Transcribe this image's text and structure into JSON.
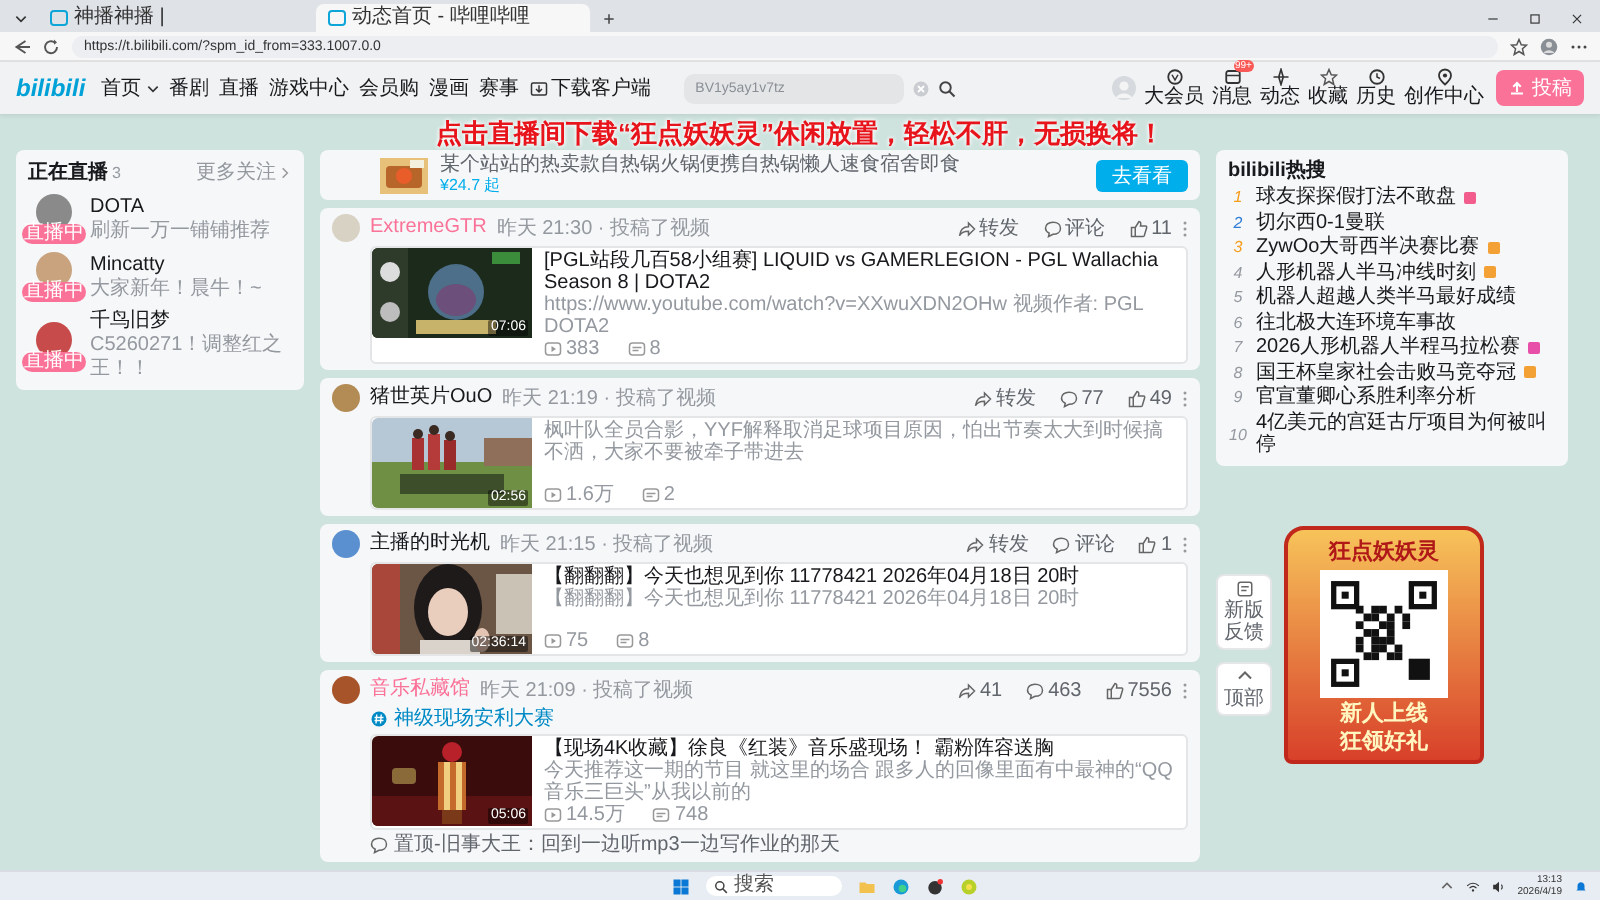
{
  "browser": {
    "tabs": [
      {
        "title": "神播神播 | ",
        "selected": false
      },
      {
        "title": "动态首页 - 哔哩哔哩",
        "selected": true
      }
    ],
    "url": "https://t.bilibili.com/?spm_id_from=333.1007.0.0"
  },
  "header": {
    "logo": "bilibili",
    "nav": [
      {
        "label": "首页",
        "kind": "dropdown"
      },
      {
        "label": "番剧",
        "kind": "link"
      },
      {
        "label": "直播",
        "kind": "link"
      },
      {
        "label": "游戏中心",
        "kind": "link"
      },
      {
        "label": "会员购",
        "kind": "link"
      },
      {
        "label": "漫画",
        "kind": "link"
      },
      {
        "label": "赛事",
        "kind": "link"
      },
      {
        "label": "下载客户端",
        "kind": "download"
      }
    ],
    "search": {
      "placeholder": "BV1y5ay1v7tz"
    },
    "user_menu": [
      {
        "label": "大会员",
        "kind": "vip"
      },
      {
        "label": "消息",
        "kind": "message",
        "badge": "99+"
      },
      {
        "label": "动态",
        "kind": "dynamic"
      },
      {
        "label": "收藏",
        "kind": "star"
      },
      {
        "label": "历史",
        "kind": "history"
      },
      {
        "label": "创作中心",
        "kind": "creator"
      }
    ],
    "upload_button": "投稿"
  },
  "banner": "点击直播间下载“狂点妖妖灵”休闲放置，轻松不肝，无损换将！",
  "live_panel": {
    "title": "正在直播",
    "count": "3",
    "more": "更多关注",
    "items": [
      {
        "name": "DOTA",
        "subtitle": "刷新一万一铺铺推荐",
        "badge": "直播中",
        "color": "#8a8a8a"
      },
      {
        "name": "Mincatty",
        "subtitle": "大家新年！晨牛！~",
        "badge": "直播中",
        "color": "#c9a27e"
      },
      {
        "name": "千鸟旧梦",
        "subtitle": "C5260271！调整红之王！！",
        "badge": "直播中",
        "color": "#c84b4b"
      }
    ]
  },
  "promo": {
    "text": "某个站站的热卖款自热锅火锅便携自热锅懒人速食宿舍即食",
    "price": "¥24.7 起",
    "button": "去看看"
  },
  "posts": [
    {
      "author": "ExtremeGTR",
      "vip": true,
      "time": "昨天 21:30 · 投稿了视频",
      "kind": "picture",
      "duration": "07:06",
      "title": "[PGL站段几百58小组赛] LIQUID vs GAMERLEGION - PGL Wallachia Season 8 | DOTA2",
      "desc": "https://www.youtube.com/watch?v=XXwuXDN2OHw 视频作者: PGL DOTA2",
      "views": "383",
      "danmaku": "8",
      "actions": [
        {
          "kind": "share",
          "label": "转发"
        },
        {
          "kind": "comment",
          "label": "评论"
        },
        {
          "kind": "like",
          "label": "11"
        }
      ]
    },
    {
      "author": "猪世英片OuO",
      "vip": false,
      "time": "昨天 21:19 · 投稿了视频",
      "kind": "picture",
      "duration": "02:56",
      "desc": "枫叶队全员合影，YYF解释取消足球项目原因，怕出节奏太大到时候搞不洒，大家不要被牵子带进去",
      "views": "1.6万",
      "danmaku": "2",
      "actions": [
        {
          "kind": "share",
          "label": "转发"
        },
        {
          "kind": "comment",
          "label": "77"
        },
        {
          "kind": "like",
          "label": "49"
        }
      ]
    },
    {
      "author": "主播的时光机",
      "vip": false,
      "time": "昨天 21:15 · 投稿了视频",
      "kind": "picture",
      "duration": "02:36:14",
      "title": "【翻翻翻】今天也想见到你 11778421 2026年04月18日 20时",
      "desc": "【翻翻翻】今天也想见到你 11778421 2026年04月18日 20时",
      "views": "75",
      "danmaku": "8",
      "actions": [
        {
          "kind": "share",
          "label": "转发"
        },
        {
          "kind": "comment",
          "label": "评论"
        },
        {
          "kind": "like",
          "label": "1"
        }
      ]
    },
    {
      "author": "音乐私藏馆",
      "vip": true,
      "time": "昨天 21:09 · 投稿了视频",
      "topic": "神级现场安利大赛",
      "kind": "picture",
      "duration": "05:06",
      "title": "【现场4K收藏】徐良《红装》音乐盛现场！ 霸粉阵容送胸",
      "desc": "今天推荐这一期的节目 就这里的场合 跟多人的回像里面有中最神的“QQ音乐三巨头”从我以前的",
      "views": "14.5万",
      "danmaku": "748",
      "comment": "置顶-旧事大王：回到一边听mp3一边写作业的那天",
      "actions": [
        {
          "kind": "share",
          "label": "41"
        },
        {
          "kind": "comment",
          "label": "463"
        },
        {
          "kind": "like",
          "label": "7556"
        }
      ]
    }
  ],
  "hot_panel": {
    "title": "bilibili热搜",
    "items": [
      {
        "rank": "1",
        "title": "球友探探假打法不敢盘",
        "color": "#f25d8e"
      },
      {
        "rank": "2",
        "title": "切尔西0-1曼联"
      },
      {
        "rank": "3",
        "title": "ZywOo大哥西半决赛比赛",
        "color": "#f3a034"
      },
      {
        "rank": "4",
        "title": "人形机器人半马冲线时刻",
        "color": "#f3a034"
      },
      {
        "rank": "5",
        "title": "机器人超越人类半马最好成绩"
      },
      {
        "rank": "6",
        "title": "往北极大连环境车事故"
      },
      {
        "rank": "7",
        "title": "2026人形机器人半程马拉松赛",
        "color": "#e84fa8"
      },
      {
        "rank": "8",
        "title": "国王杯皇家社会击败马竞夺冠",
        "color": "#f3a034"
      },
      {
        "rank": "9",
        "title": "官宣董卿心系胜利率分析"
      },
      {
        "rank": "10",
        "title": "4亿美元的宫廷古厅项目为何被叫停"
      }
    ]
  },
  "side_buttons": [
    {
      "label": "新版反馈",
      "kind": "feedback"
    },
    {
      "label": "顶部",
      "kind": "top"
    }
  ],
  "ad": {
    "title": "狂点妖妖灵",
    "lines": [
      "新人上线",
      "狂领好礼"
    ]
  },
  "taskbar": {
    "search": "搜索",
    "time": "13:13",
    "date": "2026/4/19"
  }
}
